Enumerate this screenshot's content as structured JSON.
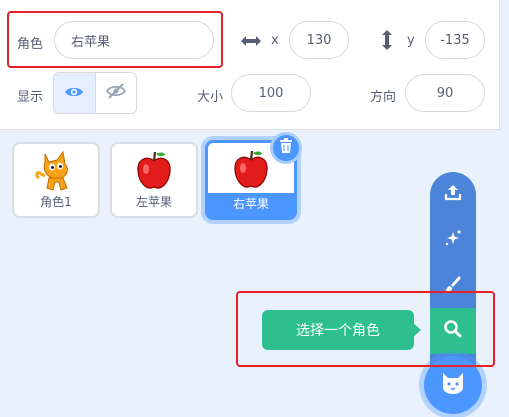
{
  "sprite_info": {
    "sprite_label": "角色",
    "sprite_name": "右苹果",
    "x_label": "x",
    "x_value": "130",
    "y_label": "y",
    "y_value": "-135",
    "show_label": "显示",
    "size_label": "大小",
    "size_value": "100",
    "direction_label": "方向",
    "direction_value": "90"
  },
  "sprites": [
    {
      "name": "角色1",
      "icon": "cat-sprite-icon",
      "selected": false
    },
    {
      "name": "左苹果",
      "icon": "apple-sprite-icon",
      "selected": false
    },
    {
      "name": "右苹果",
      "icon": "apple-sprite-icon",
      "selected": true
    }
  ],
  "sprite_menu": {
    "tooltip": "选择一个角色",
    "items": [
      "upload-icon",
      "surprise-icon",
      "paint-icon",
      "search-icon",
      "cat-icon"
    ]
  },
  "colors": {
    "accent": "#4c97ff",
    "menu_blue": "#4c84d9",
    "highlight_green": "#2dbf8e",
    "annotation_red": "#e8202a"
  }
}
